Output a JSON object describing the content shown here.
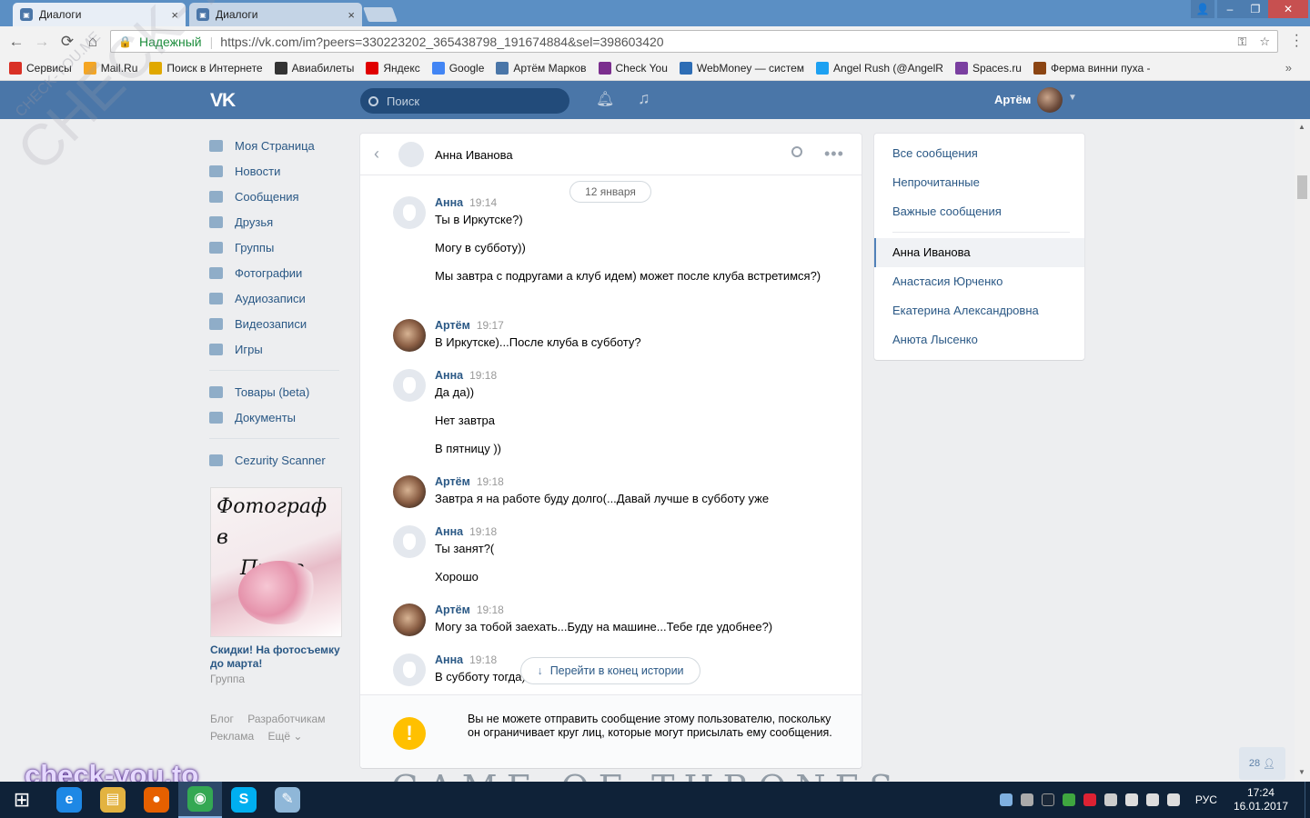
{
  "browser": {
    "tabs": [
      {
        "title": "Диалоги"
      },
      {
        "title": "Диалоги"
      }
    ],
    "window_controls": {
      "user": "👤",
      "minimize": "–",
      "maximize": "❐",
      "close": "✕"
    },
    "nav": {
      "back": "←",
      "forward": "→",
      "reload": "⟳",
      "home": "⌂",
      "tab_close": "×"
    },
    "address": {
      "secure_label": "Надежный",
      "url": "https://vk.com/im?peers=330223202_365438798_191674884&sel=398603420"
    },
    "bookmarks": [
      {
        "label": "Сервисы",
        "color": "#d93025"
      },
      {
        "label": "Mail.Ru",
        "color": "#f5a623"
      },
      {
        "label": "Поиск в Интернете",
        "color": "#e0a800"
      },
      {
        "label": "Авиабилеты",
        "color": "#333333"
      },
      {
        "label": "Яндекс",
        "color": "#e00000"
      },
      {
        "label": "Google",
        "color": "#4285f4"
      },
      {
        "label": "Артём Марков",
        "color": "#4a76a8"
      },
      {
        "label": "Check You",
        "color": "#7b2e8e"
      },
      {
        "label": "WebMoney — систем",
        "color": "#2d6db5"
      },
      {
        "label": "Angel Rush (@AngelR",
        "color": "#1da1f2"
      },
      {
        "label": "Spaces.ru",
        "color": "#7a3fa0"
      },
      {
        "label": "Ферма винни пуха -",
        "color": "#8b4513"
      }
    ]
  },
  "vk": {
    "search_placeholder": "Поиск",
    "user_name": "Артём",
    "left_menu": [
      "Моя Страница",
      "Новости",
      "Сообщения",
      "Друзья",
      "Группы",
      "Фотографии",
      "Аудиозаписи",
      "Видеозаписи",
      "Игры"
    ],
    "left_menu_2": [
      "Товары (beta)",
      "Документы"
    ],
    "left_menu_3": [
      "Cezurity Scanner"
    ],
    "ad": {
      "image_text_1": "Фотограф в",
      "image_text_2": "Праге",
      "title": "Скидки! На фотосъемку до марта!",
      "subtitle": "Группа"
    },
    "footer": {
      "line1": [
        "Блог",
        "Разработчикам"
      ],
      "line2": [
        "Реклама",
        "Ещё ⌄"
      ]
    },
    "chat": {
      "peer_name": "Анна Иванова",
      "date_pill": "12 января",
      "groups": [
        {
          "author": "Анна",
          "time": "19:14",
          "avatar": "dog",
          "messages": [
            "Ты в Иркутске?)",
            "Могу в субботу))",
            "Мы завтра с подругами а клуб идем) может после клуба встретимся?)"
          ]
        },
        {
          "author": "Артём",
          "time": "19:17",
          "avatar": "man",
          "messages": [
            "В Иркутске)...После клуба в субботу?"
          ]
        },
        {
          "author": "Анна",
          "time": "19:18",
          "avatar": "dog",
          "messages": [
            "Да да))",
            "Нет завтра",
            "В пятницу ))"
          ]
        },
        {
          "author": "Артём",
          "time": "19:18",
          "avatar": "man",
          "messages": [
            "Завтра я на работе буду долго(...Давай лучше в субботу уже"
          ]
        },
        {
          "author": "Анна",
          "time": "19:18",
          "avatar": "dog",
          "messages": [
            "Ты занят?(",
            "Хорошо"
          ]
        },
        {
          "author": "Артём",
          "time": "19:18",
          "avatar": "man",
          "messages": [
            "Могу за тобой заехать...Буду на машине...Тебе где удобнее?)"
          ]
        },
        {
          "author": "Анна",
          "time": "19:18",
          "avatar": "dog",
          "messages": [
            "В субботу тогда)"
          ]
        }
      ],
      "goto_end": "Перейти в конец истории",
      "warning": "Вы не можете отправить сообщение этому пользователю, поскольку он ограничивает круг лиц, которые могут присылать ему сообщения."
    },
    "right_menu": {
      "filters": [
        "Все сообщения",
        "Непрочитанные",
        "Важные сообщения"
      ],
      "dialogs": [
        "Анна Иванова",
        "Анастасия Юрченко",
        "Екатерина Александровна",
        "Анюта Лысенко"
      ],
      "active_dialog": "Анна Иванова"
    },
    "friends_online": "28",
    "background_banner": "GAME OF THRONES"
  },
  "overlays": {
    "watermark": "CHECK-YOU.ME",
    "watermark_small": "CHECK-YOU.ME",
    "site_logo": "check-you.to"
  },
  "taskbar": {
    "apps": [
      {
        "name": "internet-explorer",
        "color": "#1e88e5",
        "glyph": "e"
      },
      {
        "name": "file-explorer",
        "color": "#e3b341",
        "glyph": "▤"
      },
      {
        "name": "firefox",
        "color": "#e66000",
        "glyph": "●"
      },
      {
        "name": "chrome",
        "color": "#34a853",
        "glyph": "◉"
      },
      {
        "name": "skype",
        "color": "#00aff0",
        "glyph": "S"
      },
      {
        "name": "notepad",
        "color": "#8fb7d8",
        "glyph": "✎"
      }
    ],
    "active_app": "chrome",
    "language": "РУС",
    "time": "17:24",
    "date": "16.01.2017"
  },
  "colors": {
    "vk_blue": "#4a76a8",
    "link": "#2a5885",
    "warning": "#ffc000"
  }
}
